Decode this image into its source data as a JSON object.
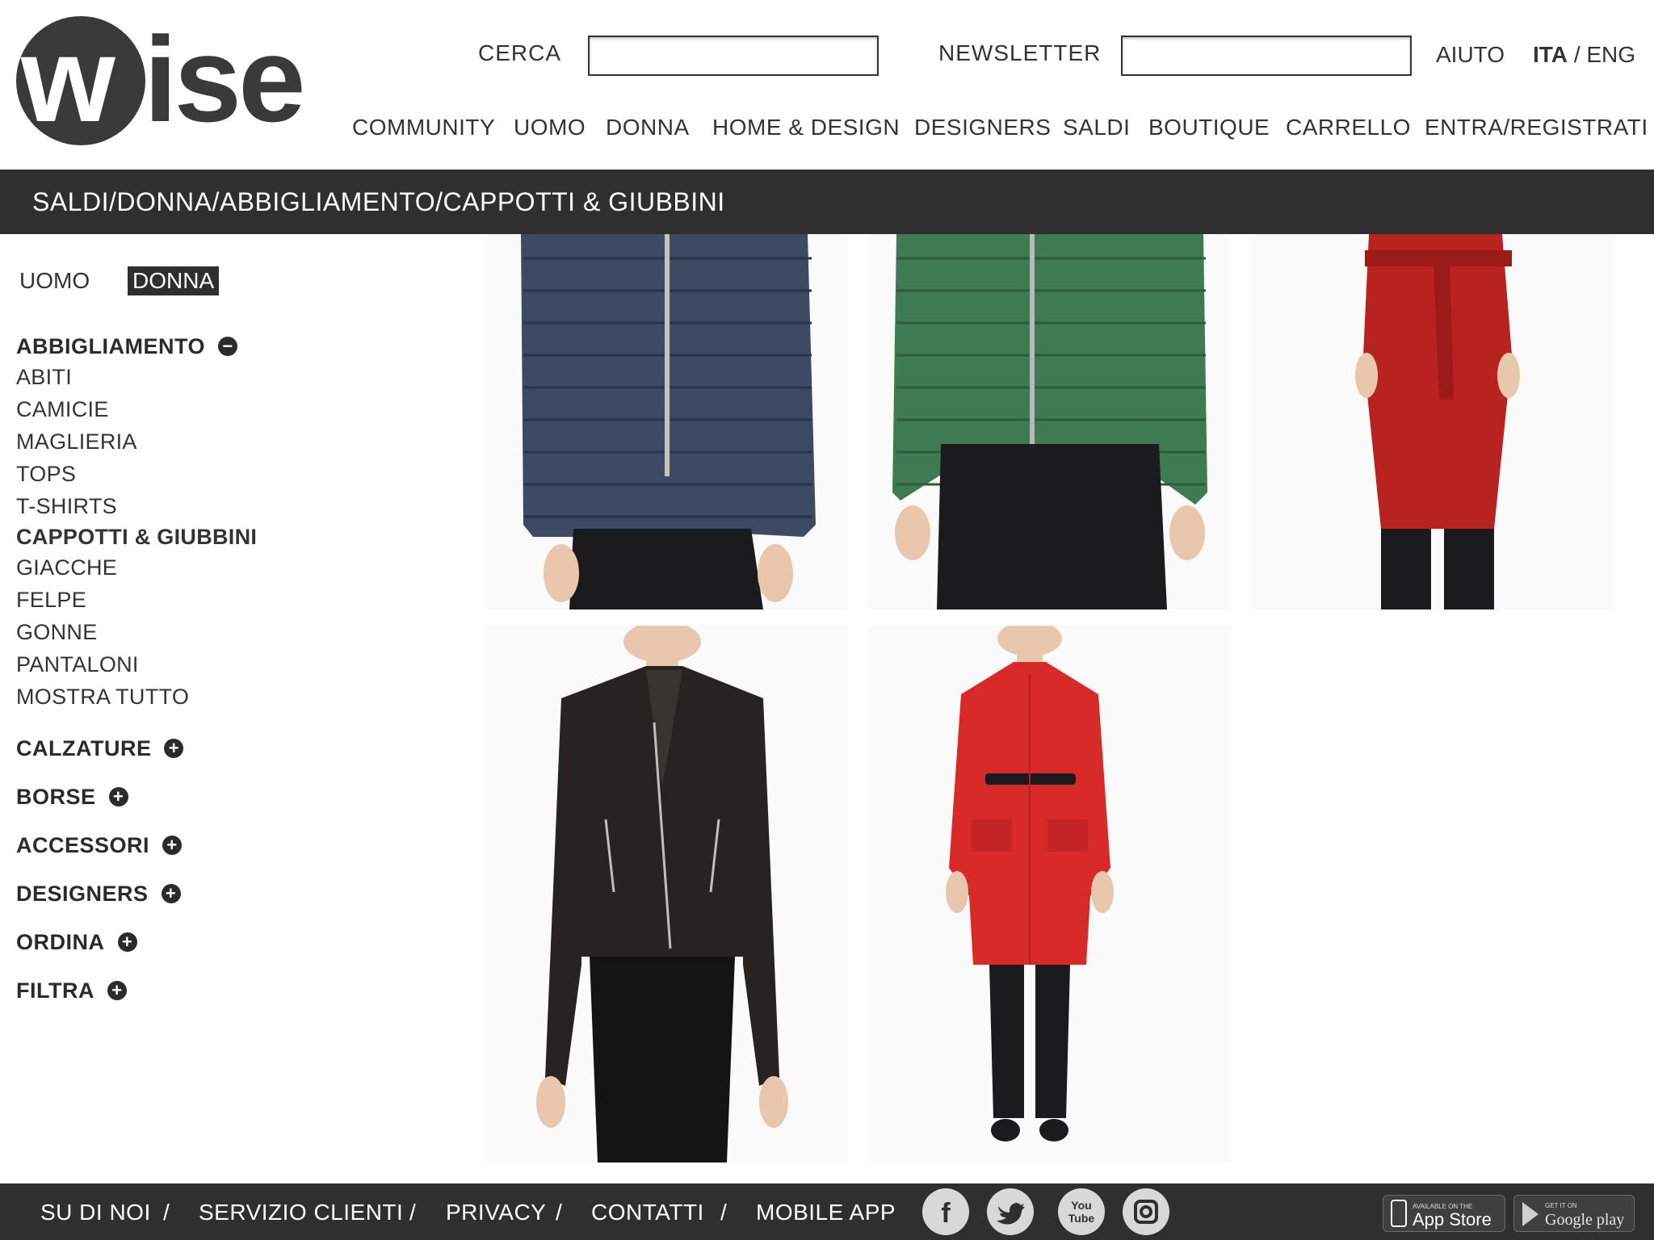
{
  "header": {
    "logo": {
      "text": "wise"
    },
    "search": {
      "label": "CERCA",
      "value": "",
      "placeholder": ""
    },
    "newsletter": {
      "label": "NEWSLETTER",
      "value": "",
      "placeholder": ""
    },
    "help": "AIUTO",
    "lang": {
      "active": "ITA",
      "separator": "/",
      "other": "ENG"
    }
  },
  "nav": [
    "COMMUNITY",
    "UOMO",
    "DONNA",
    "HOME & DESIGN",
    "DESIGNERS",
    "SALDI",
    "BOUTIQUE",
    "CARRELLO",
    "ENTRA/REGISTRATI"
  ],
  "breadcrumb": "SALDI/DONNA/ABBIGLIAMENTO/CAPPOTTI & GIUBBINI",
  "sidebar": {
    "genders": [
      {
        "label": "UOMO",
        "active": false
      },
      {
        "label": "DONNA",
        "active": true
      }
    ],
    "expanded": {
      "title": "ABBIGLIAMENTO",
      "items": [
        "ABITI",
        "CAMICIE",
        "MAGLIERIA",
        "TOPS",
        "T-SHIRTS",
        "CAPPOTTI & GIUBBINI",
        "GIACCHE",
        "FELPE",
        "GONNE",
        "PANTALONI",
        "MOSTRA TUTTO"
      ],
      "current": "CAPPOTTI & GIUBBINI"
    },
    "collapsed": [
      "CALZATURE",
      "BORSE",
      "ACCESSORI",
      "DESIGNERS",
      "ORDINA",
      "FILTRA"
    ]
  },
  "products": [
    {
      "kind": "navy quilted down jacket",
      "color": "#3d4a63"
    },
    {
      "kind": "green quilted down jacket",
      "color": "#3f7b52"
    },
    {
      "kind": "red belted wool coat",
      "color": "#b8221f"
    },
    {
      "kind": "black leather biker jacket",
      "color": "#262321"
    },
    {
      "kind": "red belted coat",
      "color": "#d92a2a"
    }
  ],
  "footer": {
    "links": [
      "SU DI NOI",
      "SERVIZIO CLIENTI",
      "PRIVACY",
      "CONTATTI",
      "MOBILE APP"
    ],
    "separator": "/",
    "social": [
      "facebook-icon",
      "twitter-icon",
      "youtube-icon",
      "instagram-icon"
    ],
    "youtube_label": [
      "You",
      "Tube"
    ],
    "app_badges": [
      {
        "small": "AVAILABLE ON THE",
        "big": "App Store"
      },
      {
        "small": "GET IT ON",
        "big": "Google play"
      }
    ]
  },
  "colors": {
    "dark_bar": "#2f2f2f",
    "text": "#2b2b2b",
    "accent_bg": "#ffffff"
  }
}
